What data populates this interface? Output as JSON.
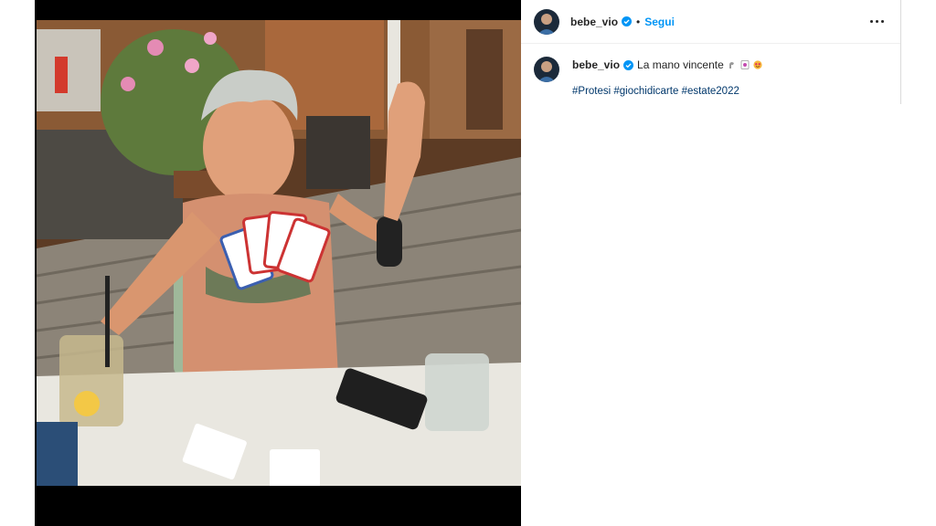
{
  "post": {
    "username": "bebe_vio",
    "separator": "•",
    "follow_label": "Segui",
    "caption_text": "La mano vincente",
    "hashtags": [
      "#Protesi",
      "#giochidicarte",
      "#estate2022"
    ]
  },
  "colors": {
    "follow": "#0095f6",
    "hashtag": "#00376b",
    "verified": "#0095f6"
  },
  "icons": {
    "verified": "verified-badge-icon",
    "more": "more-options-icon",
    "emojis": [
      "flexed-arm-emoji",
      "joker-card-emoji",
      "heart-eyes-emoji"
    ]
  }
}
